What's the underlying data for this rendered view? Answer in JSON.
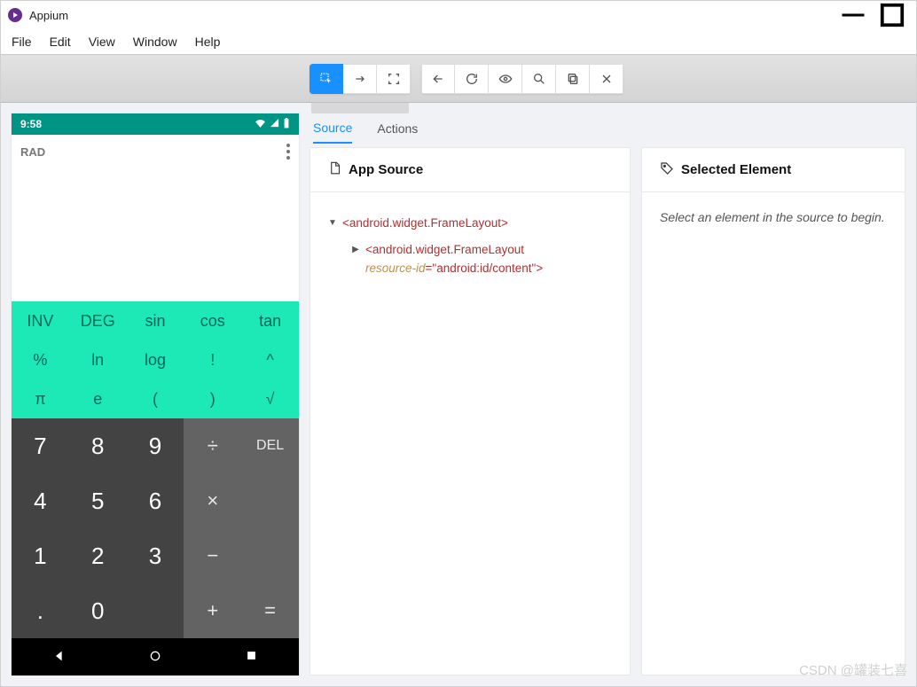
{
  "window": {
    "title": "Appium"
  },
  "menu": {
    "items": [
      "File",
      "Edit",
      "View",
      "Window",
      "Help"
    ]
  },
  "toolbar": {
    "group1": [
      "select-elements-icon",
      "swipe-icon",
      "tap-coords-icon"
    ],
    "group2": [
      "back-icon",
      "refresh-icon",
      "eye-icon",
      "search-icon",
      "copy-icon",
      "close-icon"
    ]
  },
  "tabs": {
    "items": [
      "Source",
      "Actions"
    ],
    "active": 0
  },
  "source_card": {
    "title": "App Source",
    "tree": {
      "root_open": "<android.widget.FrameLayout>",
      "child_open_tag": "<android.widget.FrameLayout ",
      "child_attr_name": "resource-id",
      "child_attr_val": "\"android:id/content\"",
      "child_close": ">"
    }
  },
  "selected_card": {
    "title": "Selected Element",
    "hint": "Select an element in the source to begin."
  },
  "device": {
    "status_time": "9:58",
    "mode_label": "RAD",
    "fn_rows": [
      [
        "INV",
        "DEG",
        "sin",
        "cos",
        "tan"
      ],
      [
        "%",
        "ln",
        "log",
        "!",
        "^"
      ],
      [
        "π",
        "e",
        "(",
        ")",
        "√"
      ]
    ],
    "num_rows": [
      [
        "7",
        "8",
        "9"
      ],
      [
        "4",
        "5",
        "6"
      ],
      [
        "1",
        "2",
        "3"
      ],
      [
        ".",
        "0",
        ""
      ]
    ],
    "op_rows": [
      [
        "÷",
        "DEL"
      ],
      [
        "×",
        ""
      ],
      [
        "−",
        ""
      ],
      [
        "+",
        "="
      ]
    ]
  },
  "watermark": "CSDN @罐装七喜"
}
